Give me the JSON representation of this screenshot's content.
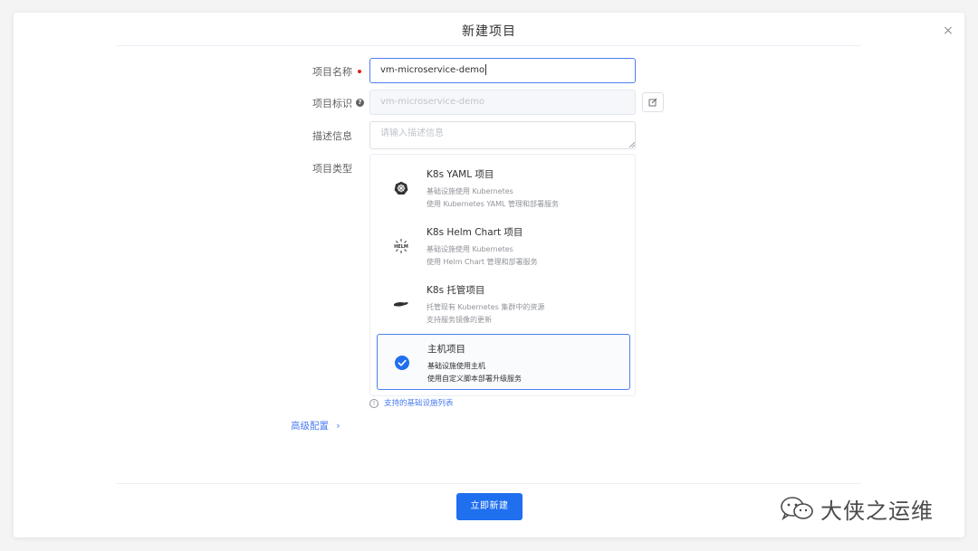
{
  "dialog": {
    "title": "新建项目",
    "close_glyph": "×"
  },
  "form": {
    "name_label": "项目名称",
    "name_value": "vm-microservice-demo",
    "key_label": "项目标识",
    "key_value": "vm-microservice-demo",
    "desc_label": "描述信息",
    "desc_placeholder": "请输入描述信息",
    "type_label": "项目类型"
  },
  "project_types": [
    {
      "title": "K8s YAML 项目",
      "line1": "基础设施使用 Kubernetes",
      "line2": "使用 Kubernetes YAML 管理和部署服务",
      "icon": "kubernetes-icon",
      "selected": false
    },
    {
      "title": "K8s Helm Chart 项目",
      "line1": "基础设施使用 Kubernetes",
      "line2": "使用 Helm Chart 管理和部署服务",
      "icon": "helm-icon",
      "selected": false
    },
    {
      "title": "K8s 托管项目",
      "line1": "托管现有 Kubernetes 集群中的资源",
      "line2": "支持服务镜像的更新",
      "icon": "hand-icon",
      "selected": false
    },
    {
      "title": "主机项目",
      "line1": "基础设施使用主机",
      "line2": "使用自定义脚本部署升级服务",
      "icon": "check-circle-icon",
      "selected": true
    }
  ],
  "infra_link": "支持的基础设施列表",
  "advanced": "高级配置",
  "submit_label": "立即新建",
  "watermark": "大侠之运维",
  "colors": {
    "accent": "#1f6fef",
    "link": "#4e7ef0",
    "required": "#e02020"
  }
}
